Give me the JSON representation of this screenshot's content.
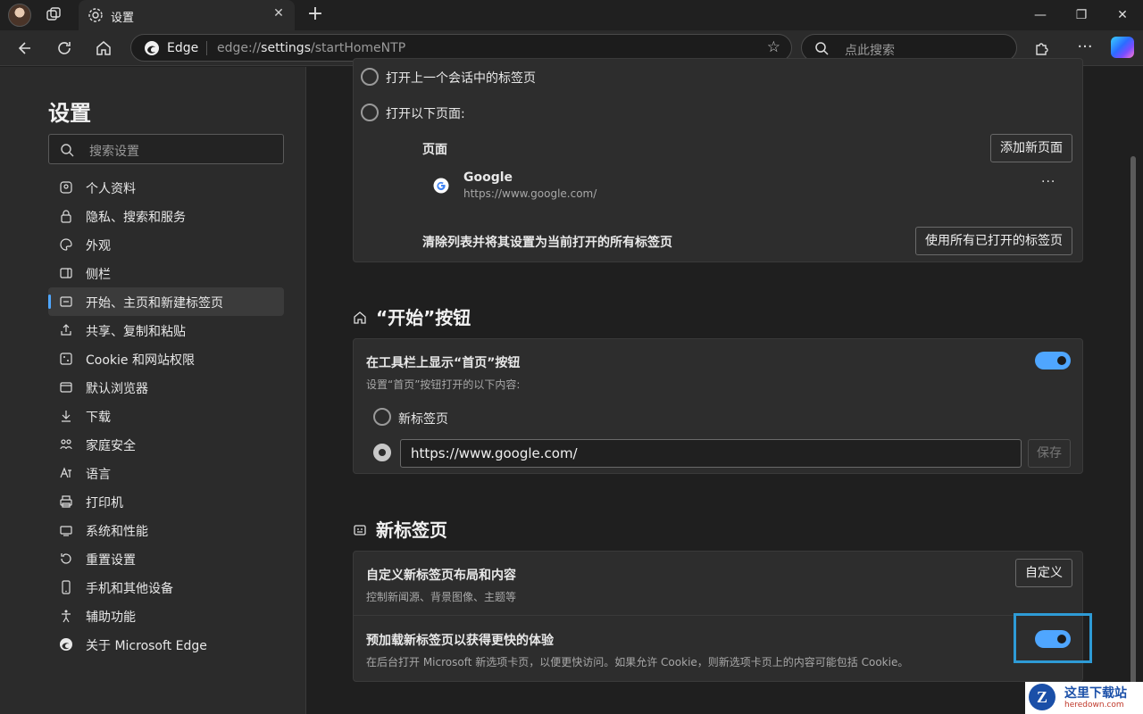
{
  "tab": {
    "title": "设置"
  },
  "toolbar": {
    "brand": "Edge",
    "url_prefix": "edge://",
    "url_host": "settings",
    "url_path": "/startHomeNTP",
    "search_placeholder": "点此搜索"
  },
  "sidebar": {
    "title": "设置",
    "search_placeholder": "搜索设置",
    "items": [
      {
        "label": "个人资料",
        "icon": "profile-icon"
      },
      {
        "label": "隐私、搜索和服务",
        "icon": "lock-icon"
      },
      {
        "label": "外观",
        "icon": "palette-icon"
      },
      {
        "label": "侧栏",
        "icon": "sidebar-icon"
      },
      {
        "label": "开始、主页和新建标签页",
        "icon": "home-tab-icon",
        "active": true
      },
      {
        "label": "共享、复制和粘贴",
        "icon": "share-icon"
      },
      {
        "label": "Cookie 和网站权限",
        "icon": "cookie-icon"
      },
      {
        "label": "默认浏览器",
        "icon": "browser-icon"
      },
      {
        "label": "下载",
        "icon": "download-icon"
      },
      {
        "label": "家庭安全",
        "icon": "family-icon"
      },
      {
        "label": "语言",
        "icon": "language-icon"
      },
      {
        "label": "打印机",
        "icon": "printer-icon"
      },
      {
        "label": "系统和性能",
        "icon": "system-icon"
      },
      {
        "label": "重置设置",
        "icon": "reset-icon"
      },
      {
        "label": "手机和其他设备",
        "icon": "phone-icon"
      },
      {
        "label": "辅助功能",
        "icon": "accessibility-icon"
      },
      {
        "label": "关于 Microsoft Edge",
        "icon": "edge-icon"
      }
    ]
  },
  "startup": {
    "option_last_session": "打开上一个会话中的标签页",
    "option_open_pages": "打开以下页面:",
    "pages_header": "页面",
    "add_page_button": "添加新页面",
    "page_name": "Google",
    "page_url": "https://www.google.com/",
    "more_button": "···",
    "clear_text": "清除列表并将其设置为当前打开的所有标签页",
    "use_all_button": "使用所有已打开的标签页"
  },
  "home_section": {
    "title": "“开始”按钮",
    "show_home_label": "在工具栏上显示“首页”按钮",
    "show_home_enabled": true,
    "sub": "设置“首页”按钮打开的以下内容:",
    "option_new_tab": "新标签页",
    "url_value": "https://www.google.com/",
    "save_button": "保存"
  },
  "ntp_section": {
    "title": "新标签页",
    "customize_label": "自定义新标签页布局和内容",
    "customize_sub": "控制新闻源、背景图像、主题等",
    "customize_button": "自定义",
    "preload_label": "预加载新标签页以获得更快的体验",
    "preload_enabled": true,
    "preload_sub": "在后台打开 Microsoft 新选项卡页，以便更快访问。如果允许 Cookie，则新选项卡页上的内容可能包括 Cookie。"
  },
  "watermark": {
    "title": "这里下载站",
    "url": "heredown.com",
    "logo": "Z"
  },
  "colors": {
    "accent": "#4fa6ff",
    "highlight": "#2e9bd6"
  }
}
